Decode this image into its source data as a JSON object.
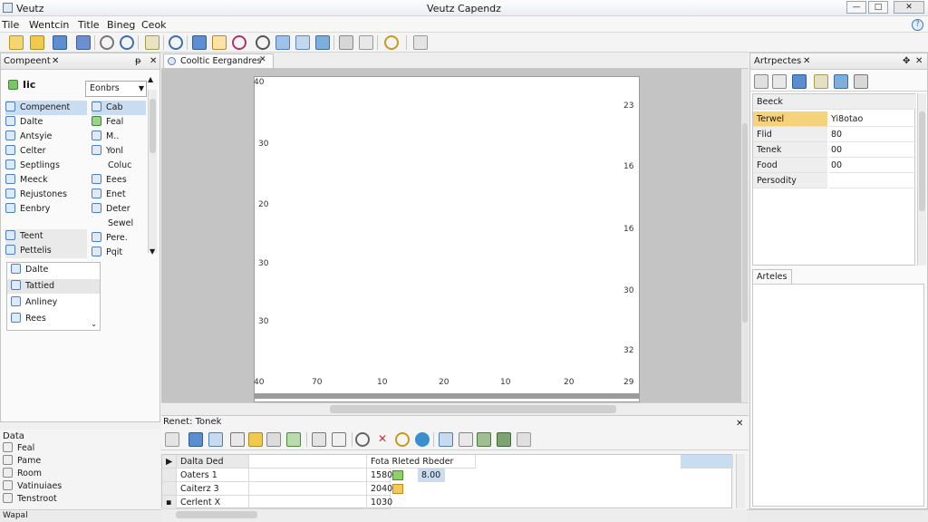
{
  "window": {
    "app_title": "Veutz",
    "title": "Veutz Capendz",
    "buttons": {
      "minimize": "—",
      "maximize": "□",
      "close": "✕"
    }
  },
  "menu": [
    "Tile",
    "Wentcin",
    "Title",
    "Bineg",
    "Ceok"
  ],
  "left_panel": {
    "title": "Compeent",
    "pin": "ᵽ",
    "close": "✕",
    "root_label": "Iic",
    "dropdown": "Eonbrs",
    "col1": [
      "Compenent",
      "Dalte",
      "Antsyie",
      "Celter",
      "Septlings",
      "Meeck",
      "Rejustones",
      "Eenbry",
      "Teent",
      "Pettelis"
    ],
    "col2": [
      "Cab",
      "Feal",
      "M..",
      "Yonl",
      "Coluc",
      "Eees",
      "Enet",
      "Deter",
      "Sewel",
      "Pere.",
      "Pqit"
    ],
    "list": [
      "Dalte",
      "Tattied",
      "Anliney",
      "Rees"
    ],
    "data_title": "Data",
    "data_items": [
      "Feal",
      "Pame",
      "Room",
      "Vatinuiaes",
      "Tenstroot"
    ],
    "footer": "Wapal"
  },
  "editor": {
    "tab": "Cooltic Eergandres",
    "tab_close": "✕",
    "y_left": [
      "40",
      "30",
      "20",
      "30",
      "30",
      "40"
    ],
    "y_right": [
      "23",
      "16",
      "16",
      "30",
      "32",
      "29"
    ],
    "x_labels": [
      "70",
      "10",
      "20",
      "10",
      "20"
    ]
  },
  "bottom": {
    "title": "Renet: Tonek",
    "close": "✕",
    "header": [
      "Dalta Ded",
      "Fota Rleted Rbeder"
    ],
    "rows": [
      {
        "name": "Oaters 1",
        "val": "1580",
        "extra": "8.00"
      },
      {
        "name": "Caiterz 3",
        "val": "2040",
        "extra": ""
      },
      {
        "name": "Cerlent X",
        "val": "1030",
        "extra": ""
      }
    ]
  },
  "right_panel": {
    "title": "Artrpectes",
    "close": "✕",
    "header": "Beeck",
    "rows": [
      {
        "k": "Terwel",
        "v": "Yi8otao"
      },
      {
        "k": "Flid",
        "v": "80"
      },
      {
        "k": "Tenek",
        "v": "00"
      },
      {
        "k": "Food",
        "v": "00"
      },
      {
        "k": "Persodity",
        "v": ""
      }
    ],
    "lower_tab": "Arteles"
  },
  "colors": {
    "accent": "#f6d27a",
    "selection": "#c8dcf2",
    "plot_bg": "#c4c4c4"
  }
}
